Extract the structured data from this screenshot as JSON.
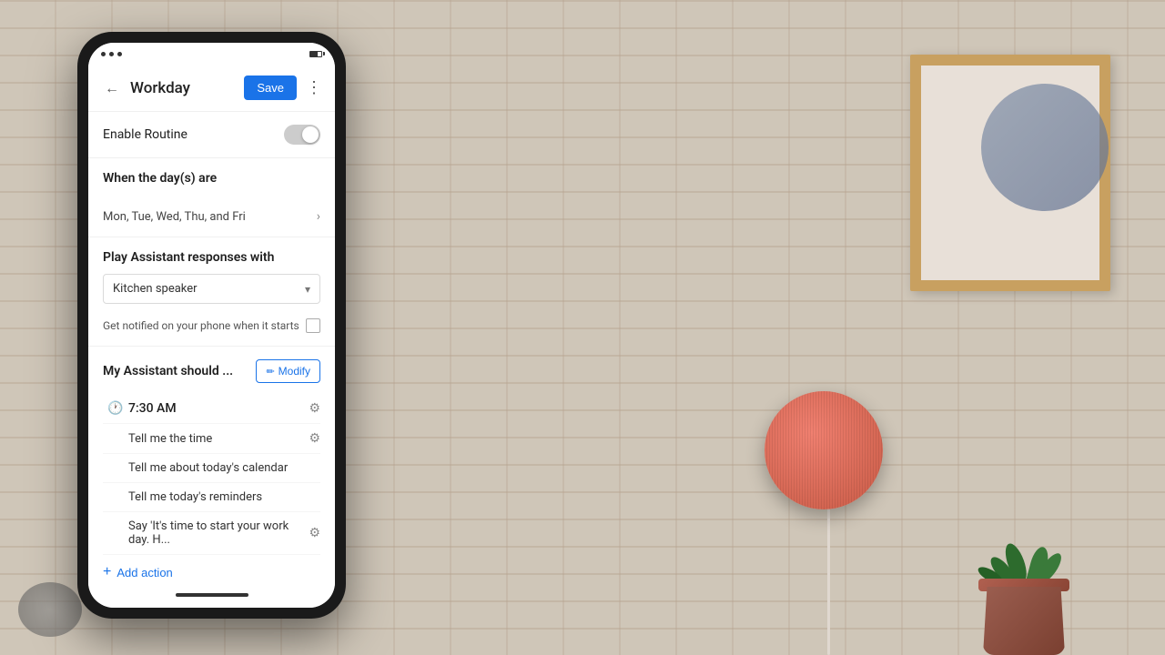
{
  "background": {
    "color": "#cfc6b8"
  },
  "phone": {
    "appBar": {
      "title": "Workday",
      "saveLabel": "Save",
      "backArrow": "←",
      "moreIcon": "⋮"
    },
    "sections": {
      "enableRoutine": {
        "label": "Enable Routine",
        "toggleOn": false
      },
      "whenDays": {
        "title": "When the day(s) are",
        "daysText": "Mon, Tue, Wed, Thu, and Fri"
      },
      "playAssistant": {
        "title": "Play Assistant responses with",
        "dropdownValue": "Kitchen speaker",
        "notificationLabel": "Get notified on your phone when it starts"
      },
      "myAssistant": {
        "title": "My Assistant should ...",
        "modifyLabel": "Modify",
        "pencilIcon": "✏",
        "actions": [
          {
            "type": "time",
            "icon": "🕐",
            "text": "7:30 AM",
            "hasGear": true
          },
          {
            "type": "command",
            "icon": "",
            "text": "Tell me the time",
            "hasGear": true
          },
          {
            "type": "command",
            "icon": "",
            "text": "Tell me about today's calendar",
            "hasGear": false
          },
          {
            "type": "command",
            "icon": "",
            "text": "Tell me today's reminders",
            "hasGear": false
          },
          {
            "type": "command",
            "icon": "",
            "text": "Say 'It's time to start your work day. H...",
            "hasGear": true
          }
        ],
        "addActionLabel": "Add action",
        "addIcon": "+"
      }
    }
  }
}
